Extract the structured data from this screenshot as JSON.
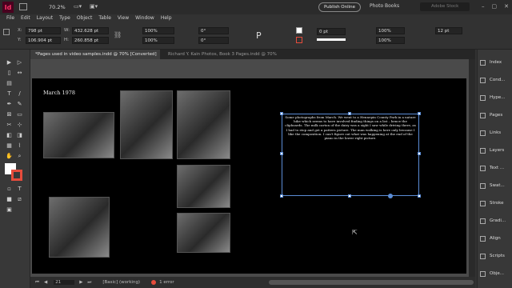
{
  "app": {
    "logo": "Id",
    "zoom": "70.2%"
  },
  "menu": [
    "File",
    "Edit",
    "Layout",
    "Type",
    "Object",
    "Table",
    "View",
    "Window",
    "Help"
  ],
  "header": {
    "publish_label": "Publish Online",
    "workspace": "Photo Books",
    "search_placeholder": "Adobe Stock"
  },
  "control": {
    "x": "798 pt",
    "y": "106.904 pt",
    "w": "432.628 pt",
    "h": "260.858 pt",
    "scale_x": "100%",
    "scale_y": "100%",
    "rotate": "0°",
    "shear": "0°",
    "stroke": "0 pt",
    "pct1": "100%",
    "pct2": "100%",
    "font_size": "12 pt"
  },
  "tabs": [
    {
      "label": "*Pages used in video samples.indd @ 70% [Converted]"
    },
    {
      "label": "Richard Y. Kain Photos, Book 3 Pages.indd @ 70%"
    }
  ],
  "document": {
    "caption": "March 1978",
    "frame_text": "Some photographs from March. We went to a Hennepin County Park in a nature hike which seems to have involved finding things on a list – hence the clipboards. The milk carton of the dairy was a sight I saw while driving there, as I had to stop and get a pattern picture. The man walking is here only because I like the composition. I can't figure out what was happening at the end of the piano in the lower right picture."
  },
  "status": {
    "page": "21",
    "style": "[Basic] (working)",
    "errors": "1 error"
  },
  "panels": [
    "Index",
    "Cond...",
    "Hype...",
    "Pages",
    "Links",
    "Layers",
    "Text ...",
    "Swat...",
    "Stroke",
    "Gradi...",
    "Align",
    "Scripts",
    "Obje..."
  ],
  "colors": {
    "accent": "#ff3366",
    "selection": "#5b8dd6",
    "error": "#e74c3c"
  }
}
